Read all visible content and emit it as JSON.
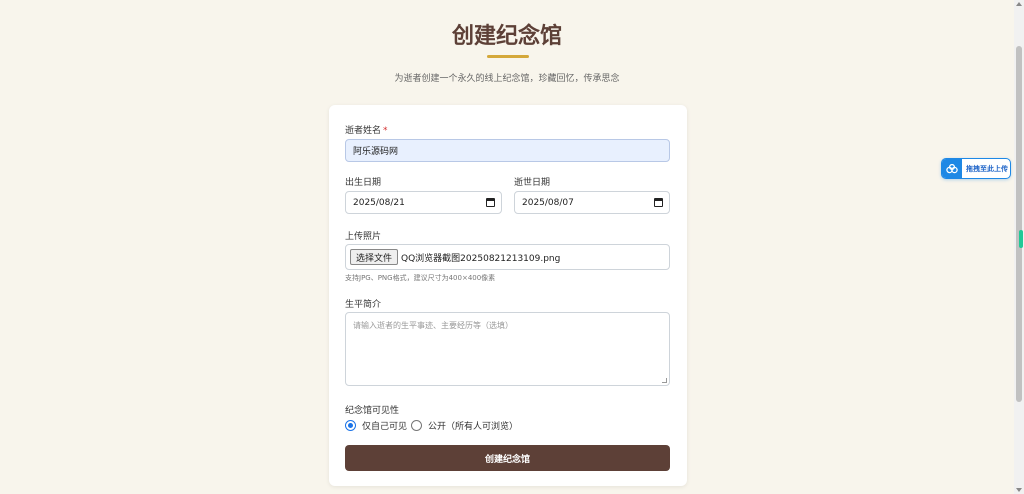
{
  "header": {
    "title": "创建纪念馆",
    "subtitle": "为逝者创建一个永久的线上纪念馆，珍藏回忆，传承思念"
  },
  "form": {
    "name": {
      "label": "逝者姓名",
      "required_mark": "*",
      "value": "阿乐源码网"
    },
    "birth_date": {
      "label": "出生日期",
      "value": "2025/08/21"
    },
    "death_date": {
      "label": "逝世日期",
      "value": "2025/08/07"
    },
    "photo": {
      "label": "上传照片",
      "button_label": "选择文件",
      "file_name": "QQ浏览器截图20250821213109.png",
      "help": "支持JPG、PNG格式，建议尺寸为400×400像素"
    },
    "bio": {
      "label": "生平简介",
      "placeholder": "请输入逝者的生平事迹、主要经历等（选填）"
    },
    "visibility": {
      "label": "纪念馆可见性",
      "options": [
        {
          "label": "仅自己可见",
          "checked": true
        },
        {
          "label": "公开（所有人可浏览）",
          "checked": false
        }
      ]
    },
    "submit_label": "创建纪念馆"
  },
  "float_upload": {
    "label": "拖拽至此上传"
  },
  "colors": {
    "accent": "#d4a83a",
    "primary": "#5d4037",
    "background": "#f8f5ec",
    "upload_blue": "#1e88e5"
  }
}
